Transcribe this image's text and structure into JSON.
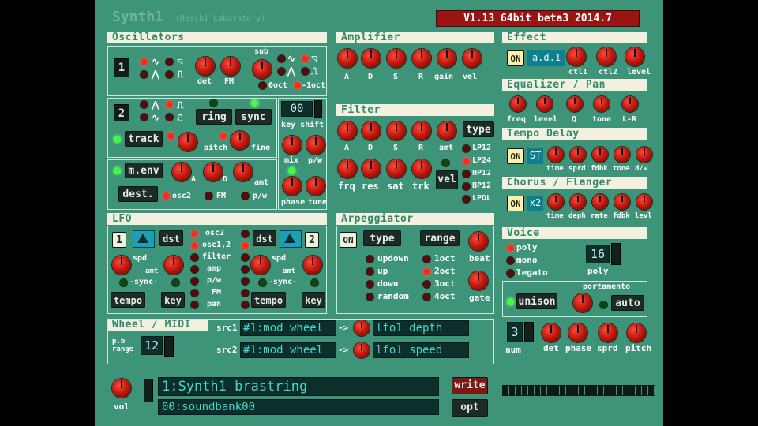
{
  "app": {
    "title": "Synth1",
    "subtitle": "(Daichi Laboratory)",
    "version": "V1.13 64bit beta3 2014.7"
  },
  "osc": {
    "title": "Oscillators",
    "osc1": "1",
    "osc2": "2",
    "det": "det",
    "fm": "FM",
    "sub": "sub",
    "oct0": "0oct",
    "oct1": "-1oct",
    "ring": "ring",
    "sync": "sync",
    "track": "track",
    "pitch": "pitch",
    "fine": "fine",
    "tune_value": "00",
    "key_shift": "key shift",
    "mix": "mix",
    "pw": "p/w",
    "menv": "m.env",
    "a": "A",
    "d": "D",
    "amt": "amt",
    "dest": "dest.",
    "d_osc2": "osc2",
    "d_fm": "FM",
    "d_pw": "p/w",
    "phase": "phase",
    "tune": "tune"
  },
  "amp": {
    "title": "Amplifier",
    "labels": [
      "A",
      "D",
      "S",
      "R",
      "gain",
      "vel"
    ]
  },
  "filter": {
    "title": "Filter",
    "labels": [
      "A",
      "D",
      "S",
      "R",
      "amt"
    ],
    "row2": [
      "frq",
      "res",
      "sat",
      "trk"
    ],
    "vel": "vel",
    "type": "type",
    "types": [
      "LP12",
      "LP24",
      "HP12",
      "BP12",
      "LPDL"
    ]
  },
  "effect": {
    "title": "Effect",
    "on": "ON",
    "type": "a.d.1",
    "labels": [
      "ctl1",
      "ctl2",
      "level"
    ]
  },
  "eq": {
    "title": "Equalizer / Pan",
    "labels": [
      "freq",
      "level",
      "Q",
      "tone",
      "L-R"
    ]
  },
  "delay": {
    "title": "Tempo Delay",
    "on": "ON",
    "type": "ST",
    "labels": [
      "time",
      "sprd",
      "fdbk",
      "tone",
      "d/w"
    ]
  },
  "chorus": {
    "title": "Chorus / Flanger",
    "on": "ON",
    "type": "x2",
    "labels": [
      "time",
      "deph",
      "rate",
      "fdbk",
      "levl"
    ]
  },
  "lfo": {
    "title": "LFO",
    "n1": "1",
    "n2": "2",
    "dst": "dst",
    "dests": [
      "osc2",
      "osc1,2",
      "filter",
      "amp",
      "p/w",
      "FM",
      "pan"
    ],
    "spd": "spd",
    "amt": "amt",
    "sync": "-sync-",
    "tempo": "tempo",
    "key": "key"
  },
  "arp": {
    "title": "Arpeggiator",
    "on": "ON",
    "type": "type",
    "range": "range",
    "types": [
      "updown",
      "up",
      "down",
      "random"
    ],
    "ranges": [
      "1oct",
      "2oct",
      "3oct",
      "4oct"
    ],
    "beat": "beat",
    "gate": "gate"
  },
  "voice": {
    "title": "Voice",
    "modes": [
      "poly",
      "mono",
      "legato"
    ],
    "poly_value": "16",
    "poly": "poly",
    "portamento": "portamento",
    "unison": "unison",
    "auto": "auto",
    "num_value": "3",
    "num": "num",
    "det": "det",
    "phase": "phase",
    "sprd": "sprd",
    "pitch": "pitch"
  },
  "wheel": {
    "title": "Wheel / MIDI",
    "pb_range": "p.b\nrange",
    "pb_value": "12",
    "src1": "src1",
    "src2": "src2",
    "src1_value": "#1:mod wheel",
    "src2_value": "#1:mod wheel",
    "arrow": "->",
    "dst1_value": "lfo1 depth",
    "dst2_value": "lfo1 speed"
  },
  "bottom": {
    "vol": "vol",
    "patch": "1:Synth1 brastring",
    "bank": "00:soundbank00",
    "write": "write",
    "opt": "opt"
  },
  "colors": {
    "panel": "#3e9478",
    "header_bg": "#f3f0df",
    "led_on": "#ff2a1a",
    "display_text": "#46d8c8",
    "version_bg": "#9a1414"
  }
}
